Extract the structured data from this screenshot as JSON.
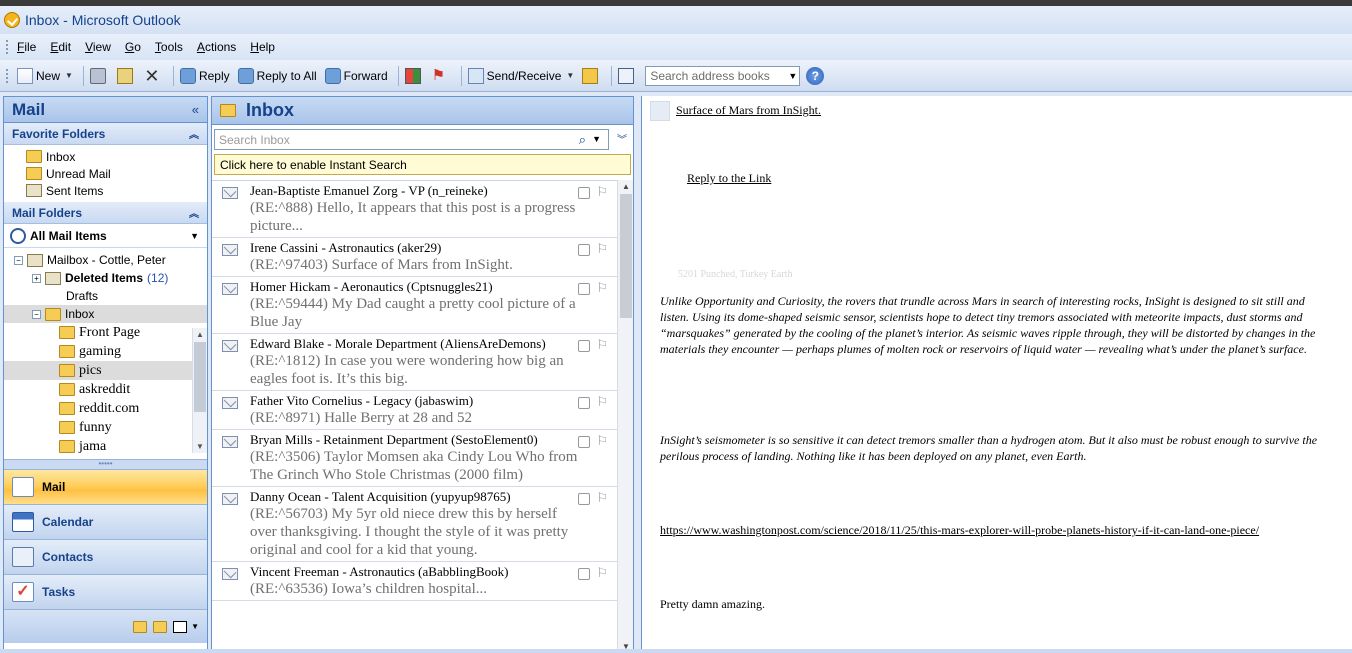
{
  "window": {
    "title": "Inbox - Microsoft Outlook"
  },
  "menu": [
    "File",
    "Edit",
    "View",
    "Go",
    "Tools",
    "Actions",
    "Help"
  ],
  "toolbar": {
    "new": "New",
    "reply": "Reply",
    "reply_all": "Reply to All",
    "forward": "Forward",
    "send_receive": "Send/Receive",
    "search_address_placeholder": "Search address books"
  },
  "nav": {
    "title": "Mail",
    "favorites_title": "Favorite Folders",
    "favorites": [
      "Inbox",
      "Unread Mail",
      "Sent Items"
    ],
    "mail_folders_title": "Mail Folders",
    "all_mail": "All Mail Items",
    "mailbox": "Mailbox - Cottle, Peter",
    "deleted": "Deleted Items",
    "deleted_count": "(12)",
    "drafts": "Drafts",
    "inbox": "Inbox",
    "subfolders": [
      "Front Page",
      "gaming",
      "pics",
      "askreddit",
      "reddit.com",
      "funny",
      "jama"
    ],
    "buttons": [
      "Mail",
      "Calendar",
      "Contacts",
      "Tasks"
    ]
  },
  "list": {
    "title": "Inbox",
    "search_placeholder": "Search Inbox",
    "instant_search": "Click here to enable Instant Search",
    "messages": [
      {
        "from": "Jean-Baptiste Emanuel Zorg - VP (n_reineke)",
        "subject": "(RE:^888) Hello, It appears that this post is a progress picture..."
      },
      {
        "from": "Irene Cassini - Astronautics (aker29)",
        "subject": "(RE:^97403) Surface of Mars from InSight."
      },
      {
        "from": "Homer Hickam - Aeronautics (Cptsnuggles21)",
        "subject": "(RE:^59444) My Dad caught a pretty cool picture of a Blue Jay"
      },
      {
        "from": "Edward Blake - Morale Department (AliensAreDemons)",
        "subject": "(RE:^1812) In case you were wondering how big an eagles foot is. It’s this big."
      },
      {
        "from": "Father Vito Cornelius - Legacy (jabaswim)",
        "subject": "(RE:^8971) Halle Berry at 28 and 52"
      },
      {
        "from": "Bryan Mills - Retainment Department (SestoElement0)",
        "subject": "(RE:^3506) Taylor Momsen aka Cindy Lou Who from The Grinch Who Stole Christmas (2000 film)"
      },
      {
        "from": "Danny Ocean - Talent Acquisition (yupyup98765)",
        "subject": "(RE:^56703) My 5yr old niece drew this by herself over thanksgiving. I thought the style of it was pretty original and cool for a kid that young."
      },
      {
        "from": "Vincent Freeman - Astronautics (aBabblingBook)",
        "subject": "(RE:^63536) Iowa’s children hospital..."
      }
    ]
  },
  "reading": {
    "title_link": "Surface of Mars from InSight.",
    "reply_link": "Reply to the Link",
    "faint_text": "5201 Punched, Turkey Earth",
    "para1": "Unlike Opportunity and Curiosity, the rovers that trundle across Mars in search of interesting rocks, InSight is designed to sit still and listen. Using its dome-shaped seismic sensor, scientists hope to detect tiny tremors associated with meteorite impacts, dust storms and “marsquakes” generated by the cooling of the planet’s interior. As seismic waves ripple through, they will be distorted by changes in the materials they encounter — perhaps plumes of molten rock or reservoirs of liquid water — revealing what’s under the planet’s surface.",
    "para2": "InSight’s seismometer is so sensitive it can detect tremors smaller than a hydrogen atom. But it also must be robust enough to survive the perilous process of landing. Nothing like it has been deployed on any planet, even Earth.",
    "url": "https://www.washingtonpost.com/science/2018/11/25/this-mars-explorer-will-probe-planets-history-if-it-can-land-one-piece/",
    "closing": "Pretty damn amazing."
  }
}
